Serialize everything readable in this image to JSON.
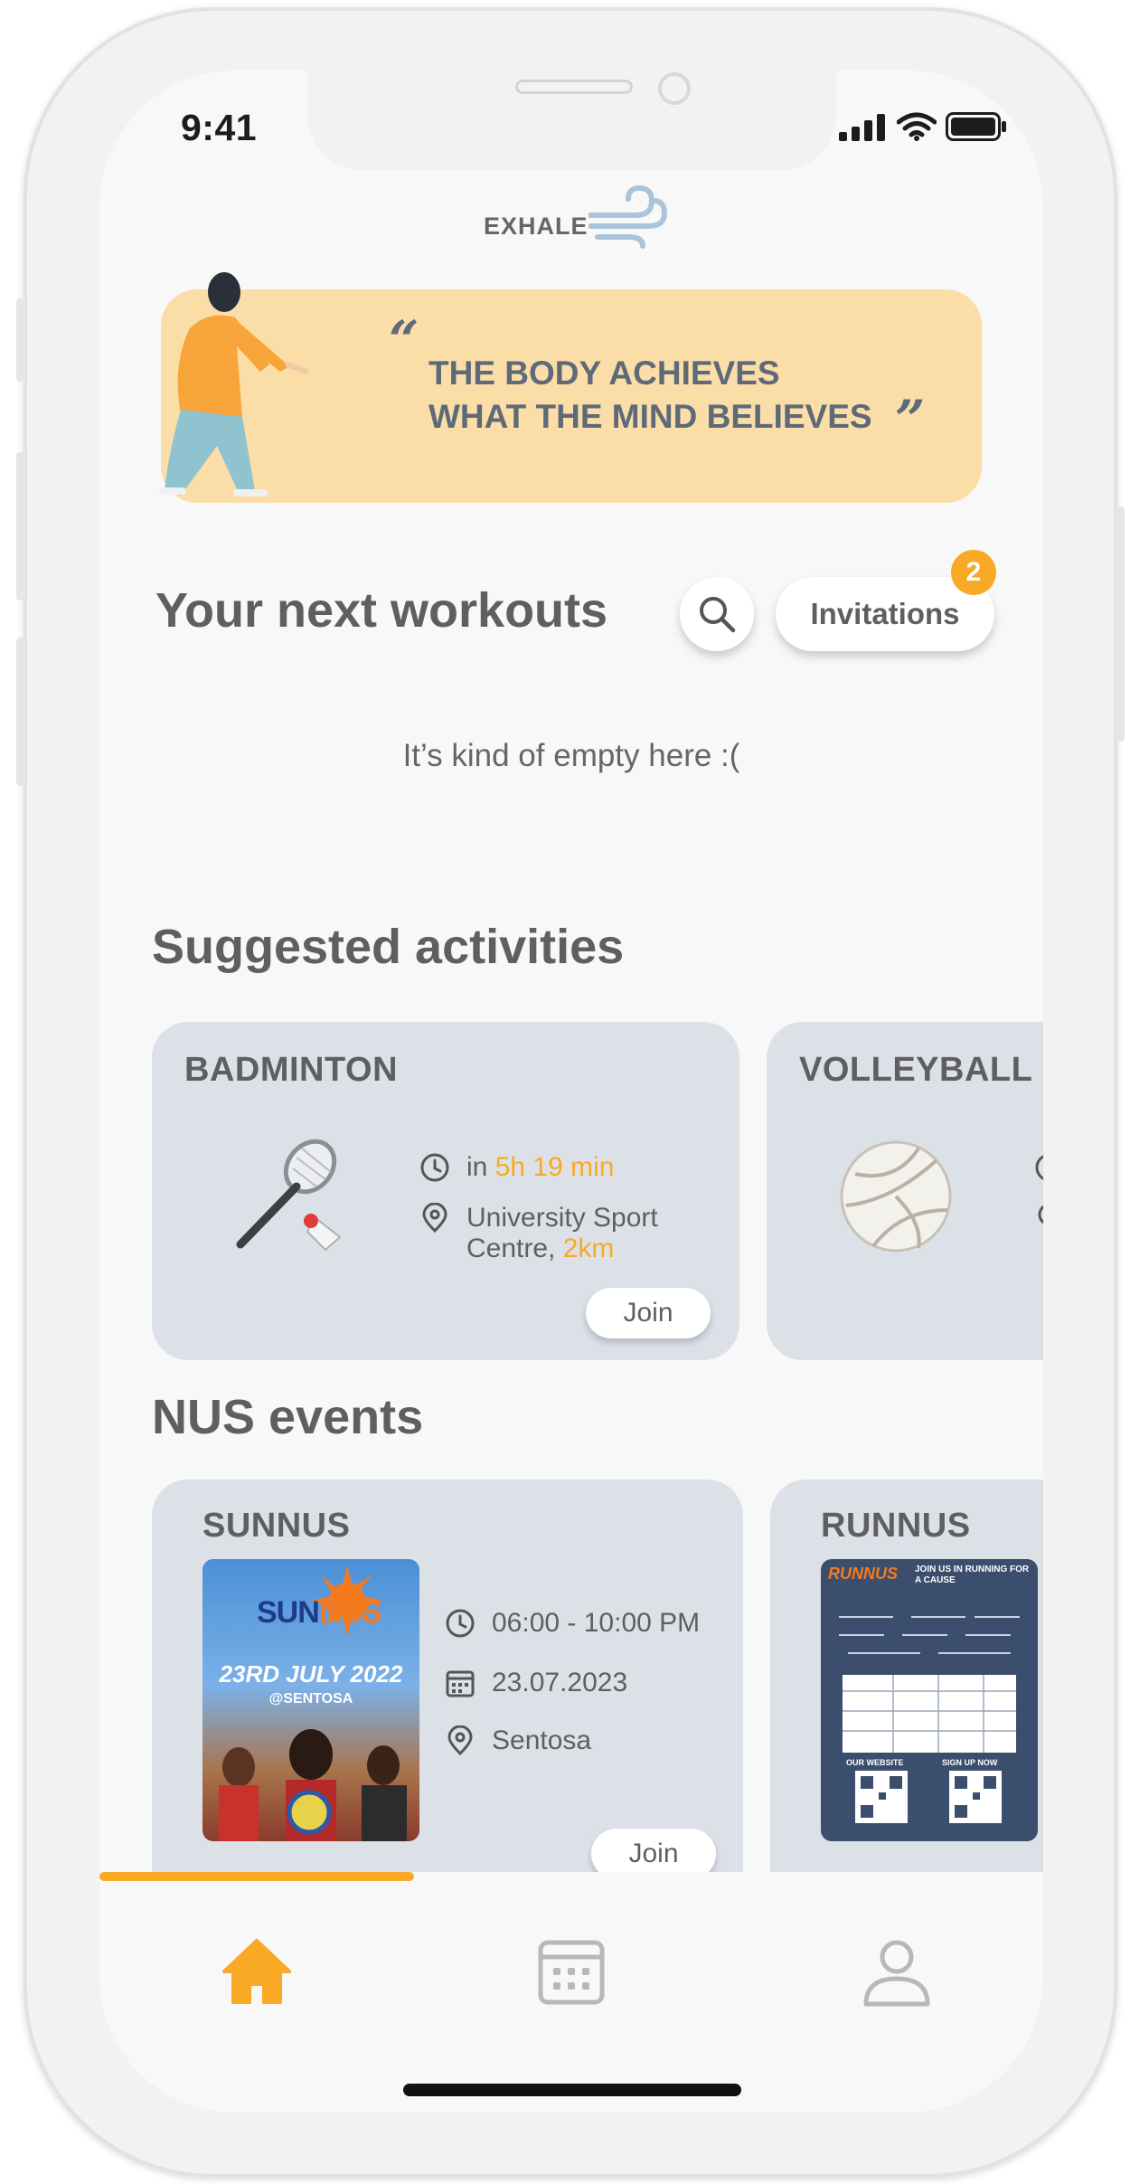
{
  "status_bar": {
    "time": "9:41"
  },
  "app": {
    "logo_text": "EXHALE"
  },
  "banner": {
    "line1": "THE BODY ACHIEVES",
    "line2": "WHAT THE MIND BELIEVES",
    "quote_open": "“",
    "quote_close": "”"
  },
  "next_workouts": {
    "title": "Your next workouts",
    "invitations_label": "Invitations",
    "invitations_count": "2",
    "empty_message": "It’s kind of empty here :("
  },
  "suggested": {
    "title": "Suggested activities",
    "cards": [
      {
        "name": "BADMINTON",
        "time_prefix": "in ",
        "time_value": "5h 19 min",
        "location_line1": "University Sport",
        "location_line2_prefix": "Centre, ",
        "distance": "2km",
        "join_label": "Join",
        "icon": "badminton-icon"
      },
      {
        "name": "VOLLEYBALL",
        "icon": "volleyball-icon"
      }
    ]
  },
  "events": {
    "title": "NUS events",
    "cards": [
      {
        "name": "SUNNUS",
        "time": "06:00 - 10:00 PM",
        "date": "23.07.2023",
        "location": "Sentosa",
        "join_label": "Join",
        "poster": {
          "brand_a": "SUN",
          "brand_b": "NUS",
          "date_text": "23RD JULY 2022",
          "venue": "@SENTOSA"
        }
      },
      {
        "name": "RUNNUS",
        "poster": {
          "brand": "RUNNUS",
          "headline": "JOIN US IN RUNNING FOR A CAUSE",
          "our_website": "OUR WEBSITE",
          "sign_up": "SIGN UP NOW"
        }
      }
    ]
  },
  "nav": {
    "items": [
      "home-icon",
      "calendar-icon",
      "profile-icon"
    ],
    "active": "home"
  },
  "colors": {
    "accent": "#f8a926",
    "card": "#dce1e8",
    "banner": "#fbdda8",
    "text": "#5f5f5f"
  }
}
